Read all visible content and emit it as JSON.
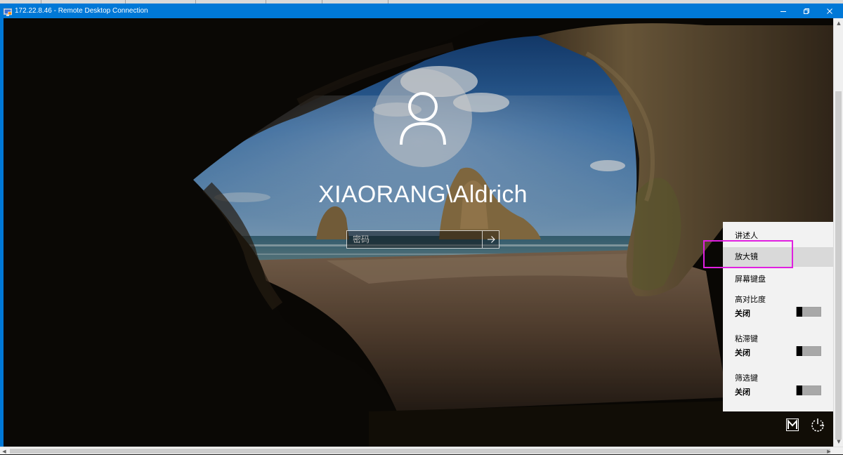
{
  "window": {
    "title": "172.22.8.46 - Remote Desktop Connection",
    "icon": "remote-desktop-icon",
    "accent": "#0078d7"
  },
  "lockscreen": {
    "username": "XIAORANG\\Aldrich",
    "password_placeholder": "密码",
    "avatar_icon": "user-silhouette-icon",
    "submit_icon": "arrow-right-icon"
  },
  "ease_menu": {
    "items": [
      {
        "label": "讲述人"
      },
      {
        "label": "放大镜",
        "selected": true
      },
      {
        "label": "屏幕键盘"
      }
    ],
    "toggles": [
      {
        "label": "高对比度",
        "state": "关闭",
        "on": false
      },
      {
        "label": "粘滞键",
        "state": "关闭",
        "on": false
      },
      {
        "label": "筛选键",
        "state": "关闭",
        "on": false
      }
    ],
    "highlight_color": "#e020e0"
  },
  "bottom_icons": {
    "ease_of_access": "ease-of-access-icon",
    "power": "power-icon"
  }
}
